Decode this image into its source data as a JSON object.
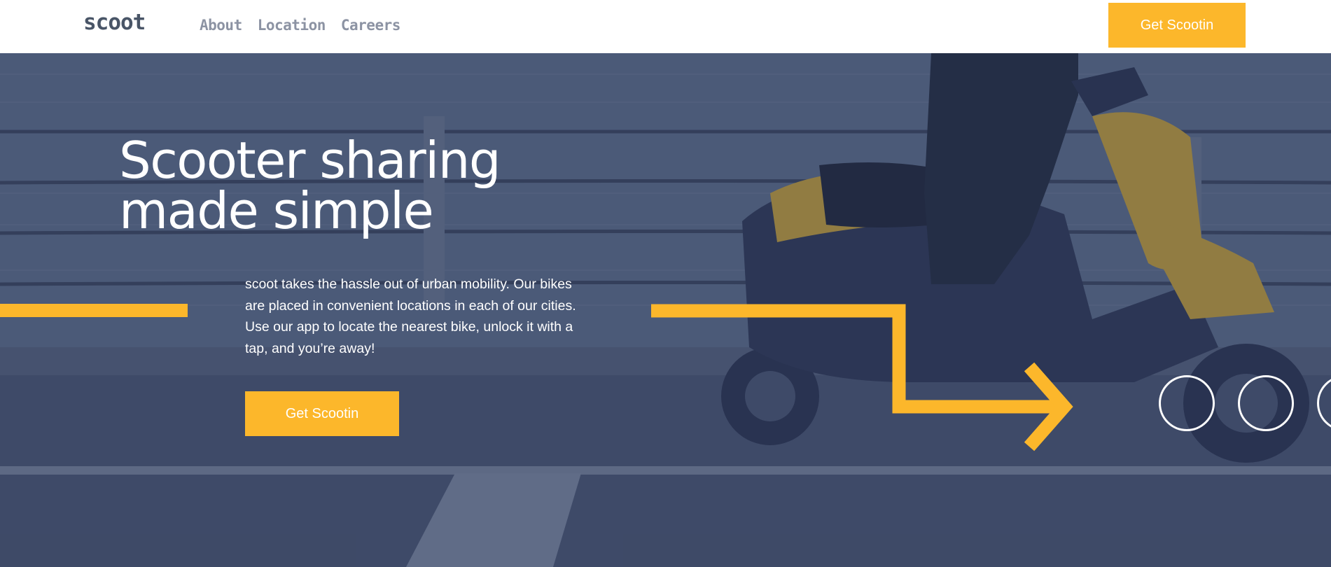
{
  "brand": {
    "logo": "scoot"
  },
  "nav": {
    "items": [
      "About",
      "Location",
      "Careers"
    ]
  },
  "header": {
    "cta_label": "Get Scootin"
  },
  "hero": {
    "title_line1": "Scooter sharing",
    "title_line2": "made simple",
    "description": "scoot takes the hassle out of urban mobility. Our bikes are placed in convenient locations in each of our cities. Use our app to locate the nearest bike, unlock it with a tap, and you’re away!",
    "cta_label": "Get Scootin"
  },
  "colors": {
    "accent": "#fcb72b",
    "overlay": "#495567",
    "nav_text": "#8c93a3",
    "logo": "#495567"
  },
  "icons": [
    "arrow-right-icon",
    "circle-icon"
  ]
}
